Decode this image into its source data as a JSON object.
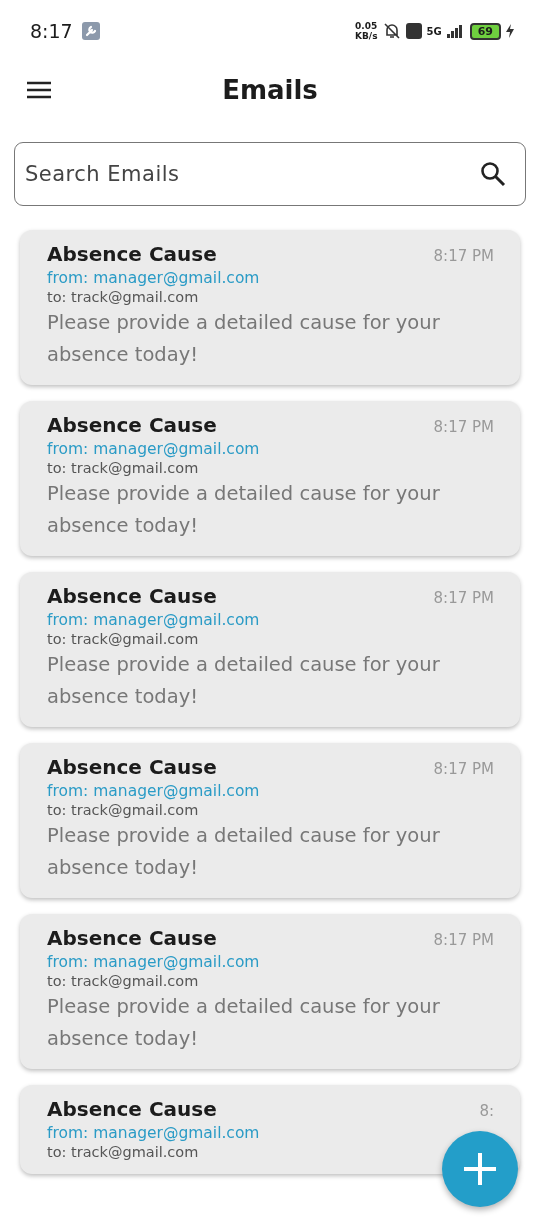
{
  "status_bar": {
    "time": "8:17",
    "net_speed": "0.05",
    "net_unit": "KB/s",
    "network": "5G",
    "battery": "69"
  },
  "header": {
    "title": "Emails"
  },
  "search": {
    "placeholder": "Search Emails"
  },
  "emails": [
    {
      "subject": "Absence Cause",
      "time": "8:17 PM",
      "from": "from: manager@gmail.com",
      "to": "to: track@gmail.com",
      "body": "Please provide a detailed cause for your absence today!"
    },
    {
      "subject": "Absence Cause",
      "time": "8:17 PM",
      "from": "from: manager@gmail.com",
      "to": "to: track@gmail.com",
      "body": "Please provide a detailed cause for your absence today!"
    },
    {
      "subject": "Absence Cause",
      "time": "8:17 PM",
      "from": "from: manager@gmail.com",
      "to": "to: track@gmail.com",
      "body": "Please provide a detailed cause for your absence today!"
    },
    {
      "subject": "Absence Cause",
      "time": "8:17 PM",
      "from": "from: manager@gmail.com",
      "to": "to: track@gmail.com",
      "body": "Please provide a detailed cause for your absence today!"
    },
    {
      "subject": "Absence Cause",
      "time": "8:17 PM",
      "from": "from: manager@gmail.com",
      "to": "to: track@gmail.com",
      "body": "Please provide a detailed cause for your absence today!"
    },
    {
      "subject": "Absence Cause",
      "time": "8:",
      "from": "from: manager@gmail.com",
      "to": "to: track@gmail.com"
    }
  ]
}
